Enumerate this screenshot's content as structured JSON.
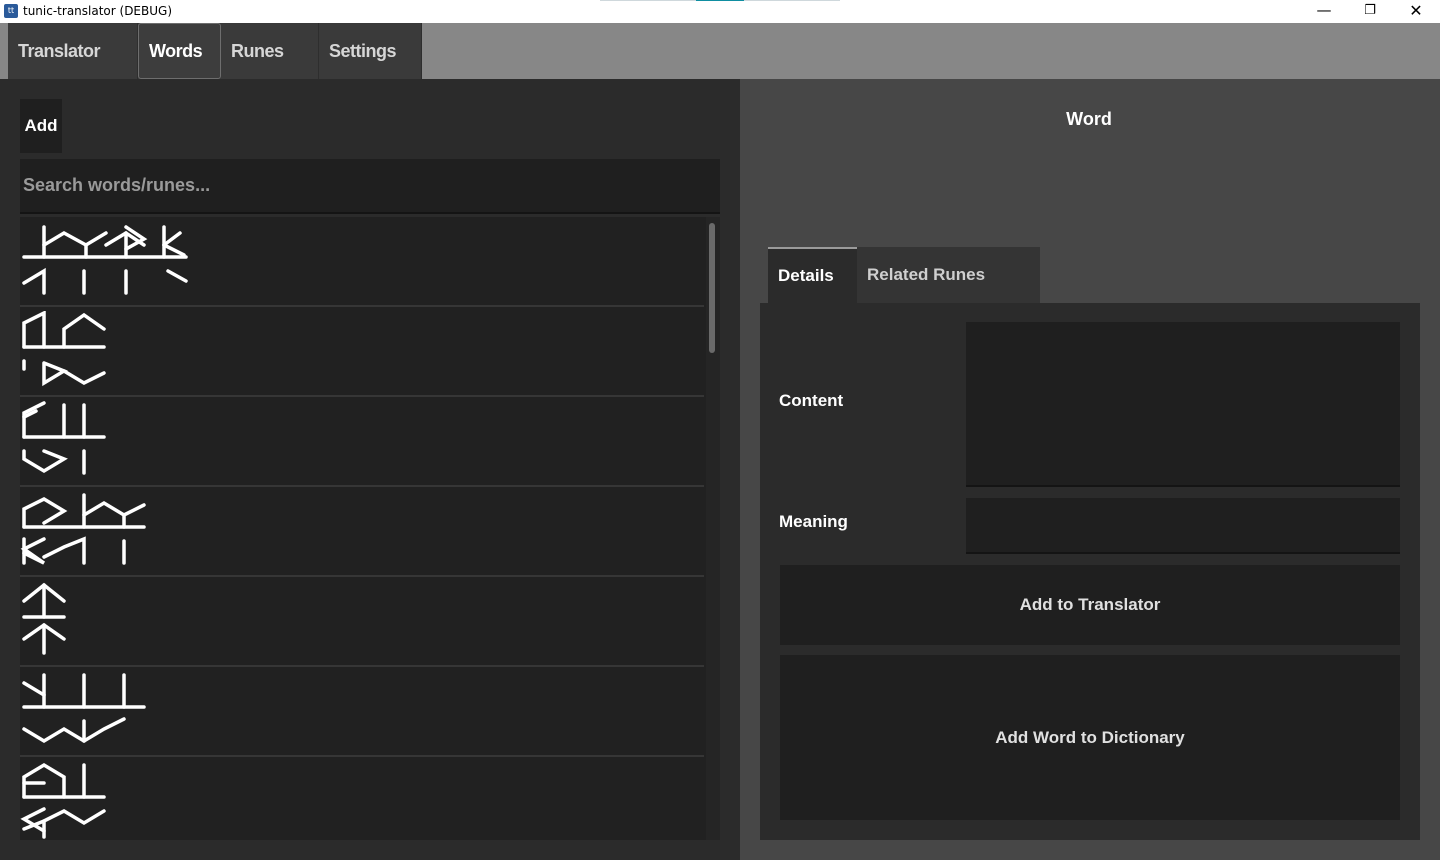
{
  "window": {
    "title": "tunic-translator (DEBUG)",
    "icon": "app-icon",
    "controls": {
      "minimize": "—",
      "maximize": "❐",
      "close": "✕"
    }
  },
  "main_tabs": [
    {
      "label": "Translator",
      "active": false
    },
    {
      "label": "Words",
      "active": true
    },
    {
      "label": "Runes",
      "active": false
    },
    {
      "label": "Settings",
      "active": false
    }
  ],
  "words_panel": {
    "add_button": "Add",
    "search_placeholder": "Search words/runes...",
    "search_value": "",
    "items_count_visible": 7
  },
  "detail_panel": {
    "word_title": "Word",
    "tabs": [
      {
        "label": "Details",
        "active": true
      },
      {
        "label": "Related Runes",
        "active": false
      }
    ],
    "content_label": "Content",
    "content_value": "",
    "meaning_label": "Meaning",
    "meaning_value": "",
    "add_to_translator_button": "Add to Translator",
    "add_word_to_dictionary_button": "Add Word to Dictionary"
  },
  "colors": {
    "tab_strip": "#878787",
    "panel_dark": "#2b2b2b",
    "panel_right": "#474747",
    "field": "#1f1f1f",
    "glyph": "#ffffff"
  }
}
